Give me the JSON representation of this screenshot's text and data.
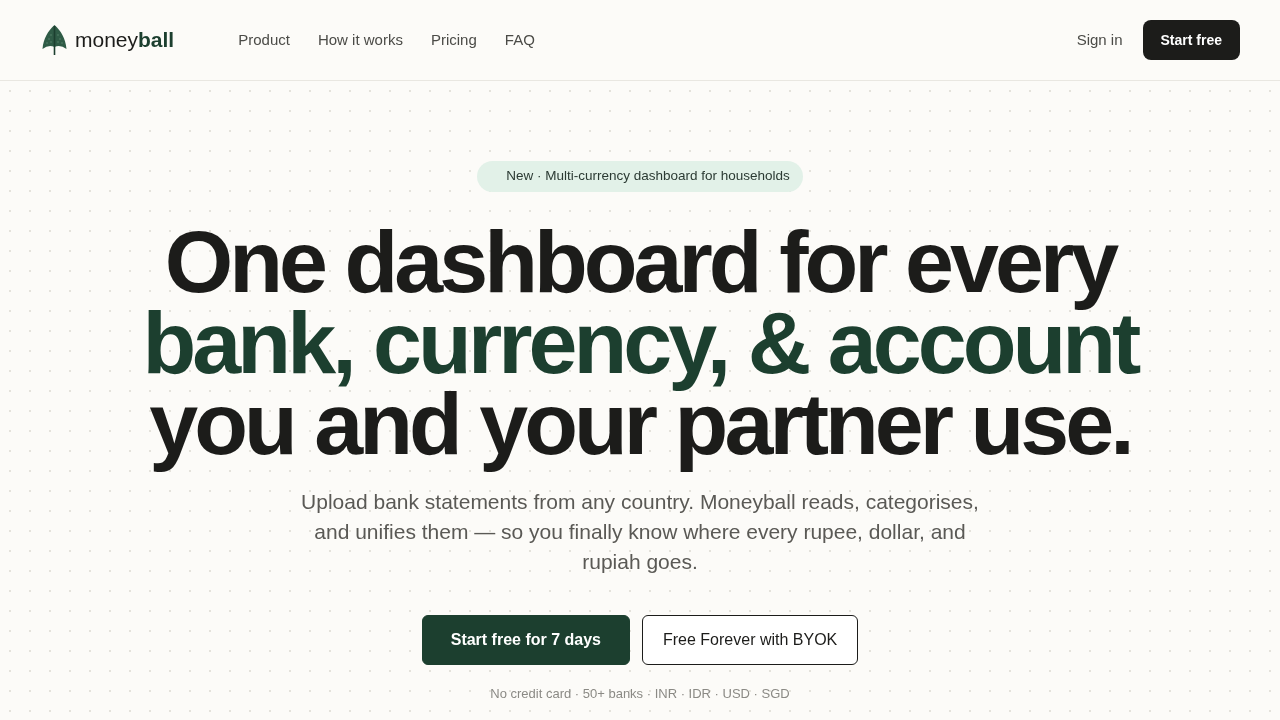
{
  "header": {
    "logo": "money**ball**",
    "nav": [
      "Product",
      "How it works",
      "Pricing",
      "FAQ"
    ],
    "sign_in": "Sign in",
    "cta": "Start free"
  },
  "hero": {
    "badge": "New · Multi-currency dashboard for households",
    "headline": [
      {
        "text": "One dashboard for every",
        "accent": false
      },
      {
        "text": "bank, currency, & account",
        "accent": true
      },
      {
        "text": "you and your partner use.",
        "accent": false
      }
    ],
    "subtitle": "Upload bank statements from any country. Moneyball reads, categorises, and unifies them — so you finally know where every rupee, dollar, and rupiah goes.",
    "buttons": [
      {
        "label": "Start free for 7 days",
        "kind": "primary"
      },
      {
        "label": "Free Forever with BYOK",
        "kind": "secondary"
      }
    ],
    "note": "No credit card · 50+ banks · INR · IDR · USD · SGD"
  }
}
